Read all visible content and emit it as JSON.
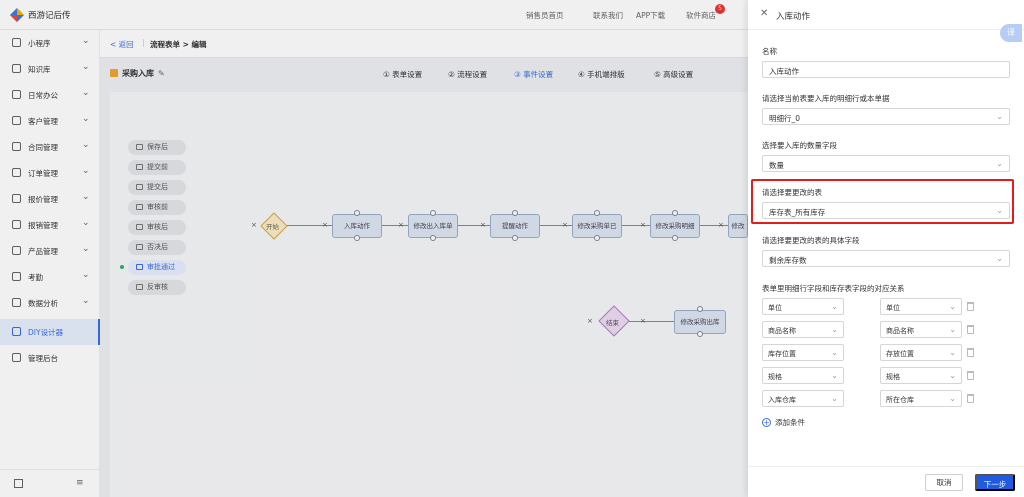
{
  "topbar": {
    "brand": "西游记后传",
    "links": [
      "销售员首页",
      "联系我们",
      "APP下载",
      "软件商店"
    ],
    "badge": "5"
  },
  "sidebar": {
    "items": [
      {
        "label": "小程序",
        "chev": "⌄"
      },
      {
        "label": "知识库",
        "chev": "⌄"
      },
      {
        "label": "日常办公",
        "chev": "⌄"
      },
      {
        "label": "客户管理",
        "chev": "⌄"
      },
      {
        "label": "合同管理",
        "chev": "⌄"
      },
      {
        "label": "订单管理",
        "chev": "⌄"
      },
      {
        "label": "报价管理",
        "chev": "⌄"
      },
      {
        "label": "报销管理",
        "chev": "⌄"
      },
      {
        "label": "产品管理",
        "chev": "⌄"
      },
      {
        "label": "考勤",
        "chev": "⌄"
      },
      {
        "label": "数据分析",
        "chev": "⌄"
      },
      {
        "label": "DIY设计器",
        "chev": ""
      },
      {
        "label": "管理后台",
        "chev": ""
      }
    ]
  },
  "main": {
    "back": "返回",
    "crumb": "流程表单 > 编辑",
    "form_title": "采购入库",
    "steps": [
      "① 表单设置",
      "② 流程设置",
      "③ 事件设置",
      "④ 手机端排版",
      "⑤ 高级设置"
    ],
    "events": [
      "保存后",
      "提交前",
      "提交后",
      "审核前",
      "审核后",
      "否决后",
      "审批通过",
      "反审核"
    ],
    "nodes": {
      "start": "开始",
      "n1": "入库动作",
      "n2": "修改出入库单",
      "n3": "提醒动作",
      "n4": "修改采购单已",
      "n5": "修改采购明细",
      "n6": "修改",
      "end": "结束",
      "n7": "修改采购出库"
    }
  },
  "drawer": {
    "title": "入库动作",
    "translate": "译",
    "name_label": "名称",
    "name_value": "入库动作",
    "row_label": "请选择当前表要入库的明细行或本单据",
    "row_value": "明细行_0",
    "qty_label": "选择要入库的数量字段",
    "qty_value": "数量",
    "table_label": "请选择要更改的表",
    "table_value": "库存表_所有库存",
    "field_label": "请选择要更改的表的具体字段",
    "field_value": "剩余库存数",
    "map_label": "表单里明细行字段和库存表字段的对应关系",
    "map": [
      [
        "单位",
        "单位"
      ],
      [
        "商品名称",
        "商品名称"
      ],
      [
        "库存位置",
        "存放位置"
      ],
      [
        "规格",
        "规格"
      ],
      [
        "入库仓库",
        "所在仓库"
      ]
    ],
    "add_condition": "添加条件",
    "cancel": "取消",
    "next": "下一步"
  }
}
